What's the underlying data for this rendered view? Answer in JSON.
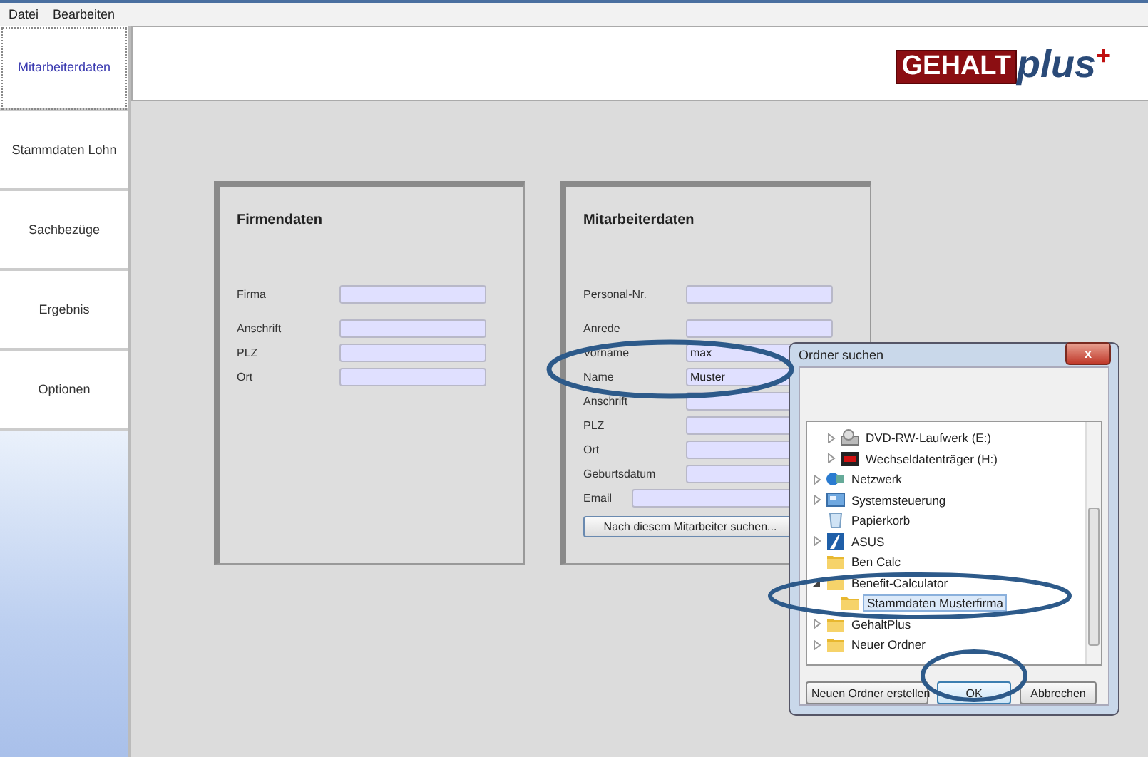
{
  "menu": [
    "Datei",
    "Bearbeiten"
  ],
  "sidebar": {
    "items": [
      {
        "label": "Mitarbeiterdaten",
        "selected": true
      },
      {
        "label": "Stammdaten Lohn",
        "selected": false
      },
      {
        "label": "Sachbezüge",
        "selected": false
      },
      {
        "label": "Ergebnis",
        "selected": false
      },
      {
        "label": "Optionen",
        "selected": false
      }
    ]
  },
  "logo": {
    "box": "GEHALT",
    "script": "plus",
    "mark": "+"
  },
  "panels": [
    {
      "title": "Firmendaten",
      "fields": [
        {
          "label": "Firma"
        },
        {
          "label": "Anschrift"
        },
        {
          "label": "PLZ"
        },
        {
          "label": "Ort"
        }
      ]
    },
    {
      "title": "Mitarbeiterdaten",
      "fields": [
        {
          "label": "Personal-Nr."
        },
        {
          "label": "Anrede"
        },
        {
          "label": "Vorname",
          "value": "max"
        },
        {
          "label": "Name",
          "value": "Muster"
        },
        {
          "label": "Anschrift"
        },
        {
          "label": "PLZ"
        },
        {
          "label": "Ort"
        },
        {
          "label": "Geburtsdatum"
        },
        {
          "label": "Email",
          "kind": "wide"
        }
      ],
      "button": "Nach diesem Mitarbeiter suchen..."
    }
  ],
  "dialog": {
    "title": "Ordner suchen",
    "close": "x",
    "nested_items": [
      {
        "label": "DVD-RW-Laufwerk (E:)",
        "kind": "drive",
        "expanded": false,
        "selected": false
      },
      {
        "label": "Wechseldatenträger (H:)",
        "kind": "removable",
        "expanded": false,
        "selected": false
      }
    ],
    "items": [
      {
        "label": "Netzwerk",
        "kind": "network",
        "expanded": false,
        "selected": false
      },
      {
        "label": "Systemsteuerung",
        "kind": "control",
        "expanded": false,
        "selected": false
      },
      {
        "label": "Papierkorb",
        "kind": "bin",
        "selected": false
      },
      {
        "label": "ASUS",
        "kind": "asus",
        "expanded": false,
        "selected": false
      },
      {
        "label": "Ben Calc",
        "kind": "folder",
        "selected": false
      },
      {
        "label": "Benefit-Calculator",
        "kind": "folder",
        "expanded": true,
        "selected": false,
        "children": [
          {
            "label": "Stammdaten Musterfirma",
            "kind": "folder",
            "selected": true
          }
        ]
      },
      {
        "label": "GehaltPlus",
        "kind": "folder",
        "expanded": false,
        "selected": false
      },
      {
        "label": "Neuer Ordner",
        "kind": "folder",
        "expanded": false,
        "selected": false
      }
    ],
    "buttons": [
      {
        "label": "Neuen Ordner erstellen",
        "default": false
      },
      {
        "label": "OK",
        "default": true
      },
      {
        "label": "Abbrechen",
        "default": false
      }
    ]
  }
}
